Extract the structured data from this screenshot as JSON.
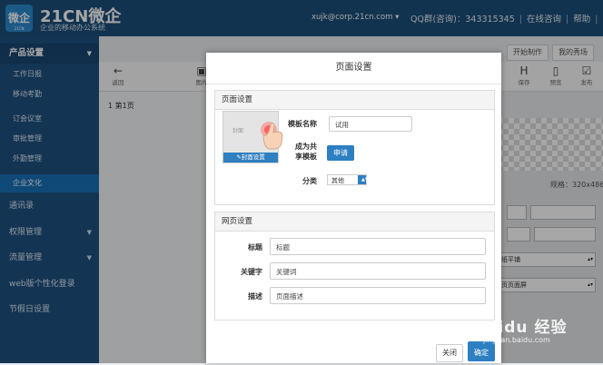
{
  "header": {
    "logo_text": "微企",
    "logo_small": "21CN",
    "brand": "21CN微企",
    "brand_sub": "企业的移动办公系统",
    "user_email": "xujk@corp.21cn.com",
    "qq_label": "QQ群(咨询)：343315345",
    "online_consult": "在线咨询",
    "help": "帮助",
    "extra": "21cr"
  },
  "sidebar": {
    "section": "产品设置",
    "items": [
      {
        "label": "工作日报"
      },
      {
        "label": "移动考勤"
      },
      {
        "label": "订会议室"
      },
      {
        "label": "审批管理"
      },
      {
        "label": "外勤管理"
      },
      {
        "label": "企业文化"
      },
      {
        "label": "通讯录"
      },
      {
        "label": "权限管理"
      },
      {
        "label": "流量管理"
      },
      {
        "label": "web版个性化登录"
      },
      {
        "label": "节假日设置"
      }
    ]
  },
  "workspace": {
    "start_btn": "开始制作",
    "showcase_btn": "我的秀场",
    "tools": {
      "back": "返回",
      "image": "图片",
      "save": "保存",
      "preview": "预览",
      "publish": "发布"
    },
    "page_item": "1  第1页",
    "size_label": "规格：320x486",
    "select_a": "纸平铺",
    "select_b": "页页面屏"
  },
  "modal": {
    "title": "页面设置",
    "page_settings": {
      "heading": "页面设置",
      "template_name_label": "模板名称",
      "template_name_value": "试用",
      "share_label_1": "成为共",
      "share_label_2": "享模板",
      "apply_button": "申请",
      "category_label": "分类",
      "category_value": "其他",
      "cover_button": "封面设置",
      "thumb_text": "封面"
    },
    "web_settings": {
      "heading": "网页设置",
      "title_label": "标题",
      "title_value": "标题",
      "keywords_label": "关键字",
      "keywords_value": "关键词",
      "desc_label": "描述",
      "desc_value": "页面描述"
    },
    "close_button": "关闭",
    "ok_button": "确定"
  },
  "watermark": {
    "text": "Baidu 经验",
    "sub": "jingyan.baidu.com"
  }
}
